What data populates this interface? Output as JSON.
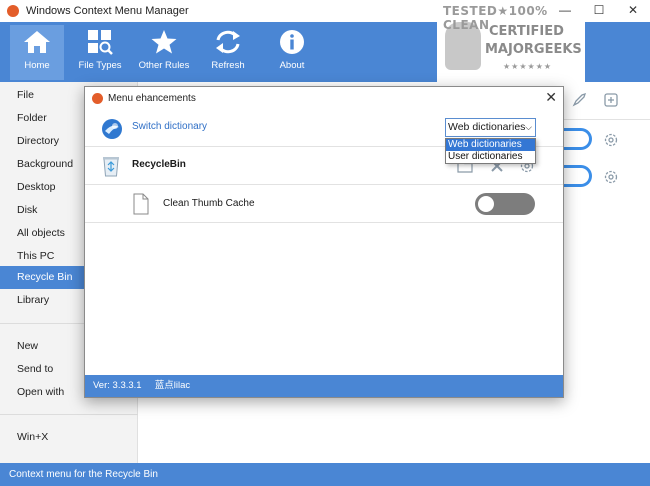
{
  "window": {
    "title": "Windows Context Menu Manager",
    "minimize": "—",
    "maximize": "☐",
    "close": "✕"
  },
  "toolbar": [
    {
      "label": "Home",
      "icon": "home-icon",
      "active": true
    },
    {
      "label": "File Types",
      "icon": "file-types-icon"
    },
    {
      "label": "Other Rules",
      "icon": "star-icon"
    },
    {
      "label": "Refresh",
      "icon": "refresh-icon"
    },
    {
      "label": "About",
      "icon": "info-icon"
    }
  ],
  "watermark": {
    "line1": "TESTED★100% CLEAN",
    "line2": "CERTIFIED",
    "line3": "MAJORGEEKS",
    "line4": "★★★★★★"
  },
  "sidebar": {
    "items": [
      "File",
      "Folder",
      "Directory",
      "Background",
      "Desktop",
      "Disk",
      "All objects",
      "This PC",
      "Recycle Bin",
      "Library",
      "New",
      "Send to",
      "Open with",
      "Win+X"
    ],
    "active": "Recycle Bin"
  },
  "dialog": {
    "title": "Menu ehancements",
    "close": "✕",
    "switch_label": "Switch dictionary",
    "select_value": "Web dictionaries",
    "select_arrow": "⌵",
    "options": [
      "Web dictionaries",
      "User dictionaries"
    ],
    "group_label": "RecycleBin",
    "item_label": "Clean Thumb Cache",
    "toggle_on": false,
    "status_version": "Ver: 3.3.3.1",
    "status_author": "蓝点lilac"
  },
  "statusbar": {
    "text": "Context menu for the Recycle Bin"
  },
  "colors": {
    "accent": "#4a86d4",
    "toggle_on": "#3b8ee8",
    "toggle_off": "#7d7d7d"
  }
}
